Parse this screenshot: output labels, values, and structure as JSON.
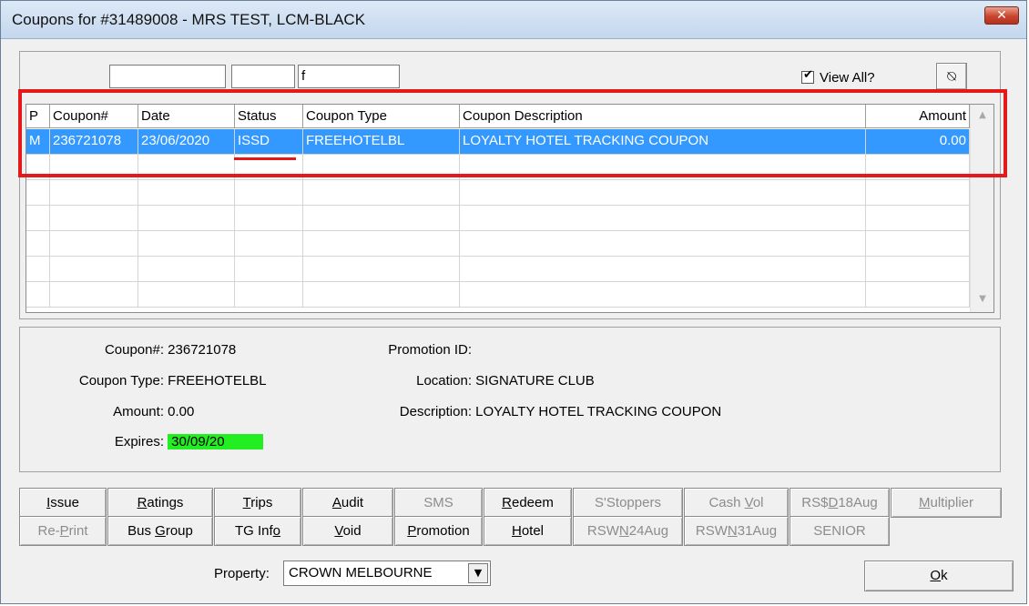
{
  "window": {
    "title": "Coupons for #31489008 - MRS TEST, LCM-BLACK",
    "close_symbol": "✕"
  },
  "filters": {
    "field1": "",
    "field2": "",
    "field3": "f"
  },
  "view_all": {
    "label": "View All?",
    "checked": true,
    "check_symbol": "✔"
  },
  "refresh_symbol": "⍉",
  "grid": {
    "columns": [
      "P",
      "Coupon#",
      "Date",
      "Status",
      "Coupon Type",
      "Coupon Description",
      "Amount"
    ],
    "rows": [
      {
        "p": "M",
        "coupon": "236721078",
        "date": "23/06/2020",
        "status": "ISSD",
        "type": "FREEHOTELBL",
        "description": "LOYALTY HOTEL TRACKING COUPON",
        "amount": "0.00",
        "selected": true
      }
    ],
    "scroll_up": "▲",
    "scroll_down": "▼"
  },
  "details": {
    "coupon_label": "Coupon#:",
    "coupon_value": "236721078",
    "type_label": "Coupon Type:",
    "type_value": "FREEHOTELBL",
    "amount_label": "Amount:",
    "amount_value": "0.00",
    "expires_label": "Expires:",
    "expires_value": "30/09/20",
    "promotion_label": "Promotion ID:",
    "promotion_value": "",
    "location_label": "Location:",
    "location_value": "SIGNATURE CLUB",
    "description_label": "Description:",
    "description_value": "LOYALTY HOTEL TRACKING COUPON"
  },
  "buttons_row1": [
    {
      "pre": "",
      "key": "I",
      "post": "ssue",
      "enabled": true
    },
    {
      "pre": "",
      "key": "R",
      "post": "atings",
      "enabled": true
    },
    {
      "pre": "",
      "key": "T",
      "post": "rips",
      "enabled": true
    },
    {
      "pre": "",
      "key": "A",
      "post": "udit",
      "enabled": true
    },
    {
      "pre": "SMS",
      "key": "",
      "post": "",
      "enabled": false
    },
    {
      "pre": "",
      "key": "R",
      "post": "edeem",
      "enabled": true
    },
    {
      "pre": "S'Stoppers",
      "key": "",
      "post": "",
      "enabled": false
    },
    {
      "pre": "Cash ",
      "key": "V",
      "post": "ol",
      "enabled": false
    },
    {
      "pre": "RS$",
      "key": "D",
      "post": "18Aug",
      "enabled": false
    },
    {
      "pre": "",
      "key": "M",
      "post": "ultiplier",
      "enabled": false
    }
  ],
  "buttons_row2": [
    {
      "pre": "Re-",
      "key": "P",
      "post": "rint",
      "enabled": false
    },
    {
      "pre": "Bus ",
      "key": "G",
      "post": "roup",
      "enabled": true
    },
    {
      "pre": "TG Inf",
      "key": "o",
      "post": "",
      "enabled": true
    },
    {
      "pre": "",
      "key": "V",
      "post": "oid",
      "enabled": true
    },
    {
      "pre": "",
      "key": "P",
      "post": "romotion",
      "enabled": true
    },
    {
      "pre": "",
      "key": "H",
      "post": "otel",
      "enabled": true
    },
    {
      "pre": "RSW",
      "key": "N",
      "post": "24Aug",
      "enabled": false
    },
    {
      "pre": "RSW",
      "key": "N",
      "post": "31Aug",
      "enabled": false
    },
    {
      "pre": "SENIOR",
      "key": "",
      "post": "",
      "enabled": false
    }
  ],
  "property": {
    "label": "Property:",
    "value": "CROWN MELBOURNE",
    "dropdown_symbol": "▼"
  },
  "ok_button": {
    "key": "O",
    "post": "k"
  }
}
